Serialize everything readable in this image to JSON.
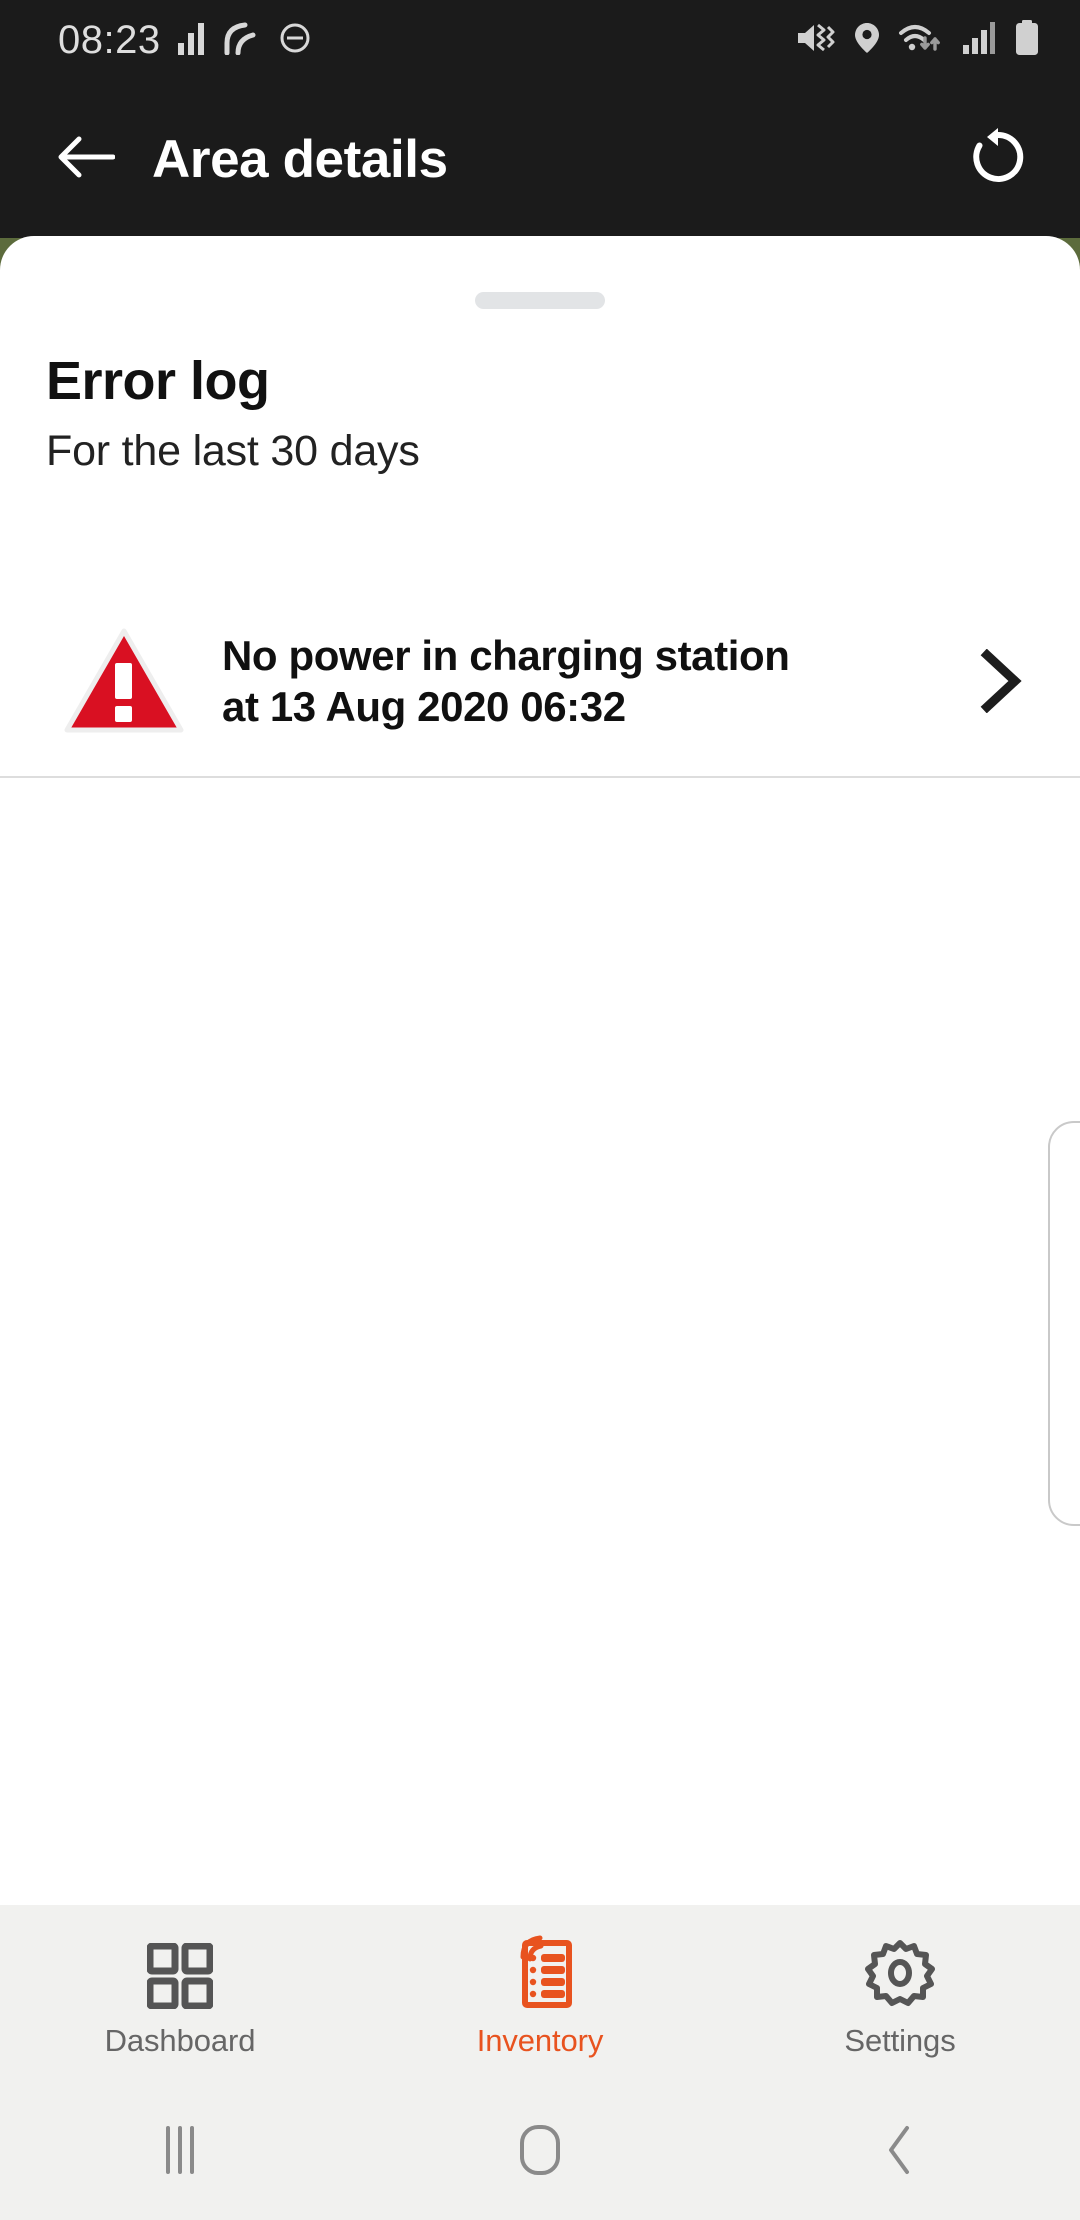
{
  "statusbar": {
    "time": "08:23",
    "left_icons": [
      "signal-bars-icon",
      "network-arc-icon",
      "do-not-disturb-icon"
    ],
    "right_icons": [
      "mute-vibrate-icon",
      "location-pin-icon",
      "wifi-transfer-icon",
      "cellular-signal-icon",
      "battery-icon"
    ]
  },
  "appbar": {
    "back_icon": "arrow-left-icon",
    "title": "Area details",
    "refresh_icon": "rotate-counterclockwise-icon"
  },
  "sheet": {
    "grabber": "drag-handle",
    "title": "Error log",
    "subtitle": "For the last 30 days"
  },
  "error_log": {
    "items": [
      {
        "severity_icon": "warning-triangle-icon",
        "message": "No power in charging station at 13 Aug 2020 06:32",
        "chevron_icon": "chevron-right-icon"
      }
    ]
  },
  "tabbar": {
    "tabs": [
      {
        "label": "Dashboard",
        "icon": "grid-dashboard-icon",
        "active": false
      },
      {
        "label": "Inventory",
        "icon": "inventory-list-icon",
        "active": true
      },
      {
        "label": "Settings",
        "icon": "gear-icon",
        "active": false
      }
    ]
  },
  "navbar": {
    "recents_icon": "recents-icon",
    "home_icon": "home-icon",
    "back_icon": "nav-back-icon"
  },
  "colors": {
    "appbar_bg": "#1b1b1b",
    "accent": "#e8531f",
    "error_red": "#d91022",
    "map_green": "#5c6b3c",
    "tabbar_bg": "#f1f1ef"
  }
}
